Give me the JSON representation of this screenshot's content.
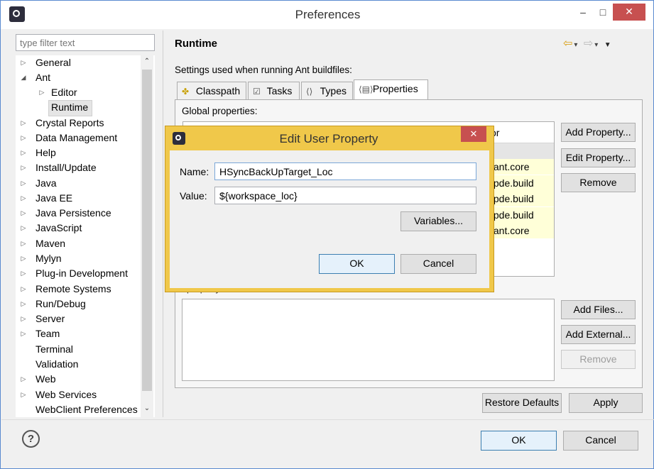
{
  "window": {
    "title": "Preferences",
    "controls": {
      "minimize": "–",
      "maximize": "□",
      "close": "✕"
    }
  },
  "sidebar": {
    "filter_placeholder": "type filter text",
    "items": [
      {
        "label": "General",
        "expandable": true,
        "expanded": false
      },
      {
        "label": "Ant",
        "expandable": true,
        "expanded": true
      },
      {
        "label": "Editor",
        "expandable": true,
        "expanded": false
      },
      {
        "label": "Runtime",
        "expandable": false,
        "selected": true
      },
      {
        "label": "Crystal Reports",
        "expandable": true
      },
      {
        "label": "Data Management",
        "expandable": true
      },
      {
        "label": "Help",
        "expandable": true
      },
      {
        "label": "Install/Update",
        "expandable": true
      },
      {
        "label": "Java",
        "expandable": true
      },
      {
        "label": "Java EE",
        "expandable": true
      },
      {
        "label": "Java Persistence",
        "expandable": true
      },
      {
        "label": "JavaScript",
        "expandable": true
      },
      {
        "label": "Maven",
        "expandable": true
      },
      {
        "label": "Mylyn",
        "expandable": true
      },
      {
        "label": "Plug-in Development",
        "expandable": true
      },
      {
        "label": "Remote Systems",
        "expandable": true
      },
      {
        "label": "Run/Debug",
        "expandable": true
      },
      {
        "label": "Server",
        "expandable": true
      },
      {
        "label": "Team",
        "expandable": true
      },
      {
        "label": "Terminal",
        "expandable": false
      },
      {
        "label": "Validation",
        "expandable": false
      },
      {
        "label": "Web",
        "expandable": true
      },
      {
        "label": "Web Services",
        "expandable": true
      },
      {
        "label": "WebClient Preferences",
        "expandable": false
      }
    ]
  },
  "page": {
    "title": "Runtime",
    "description": "Settings used when running Ant buildfiles:",
    "tabs": [
      {
        "label": "Classpath",
        "icon": "classpath-icon"
      },
      {
        "label": "Tasks",
        "icon": "tasks-icon"
      },
      {
        "label": "Types",
        "icon": "types-icon"
      },
      {
        "label": "Properties",
        "icon": "properties-icon",
        "active": true
      }
    ],
    "global_properties_label": "Global properties:",
    "table": {
      "visible_header_fragment": "or",
      "visible_cell_fragments": [
        ".ant.core",
        ".pde.build",
        ".pde.build",
        ".pde.build",
        ".ant.core"
      ]
    },
    "hidden_label_fragment": "properly",
    "buttons": {
      "add_property": "Add Property...",
      "edit_property": "Edit Property...",
      "remove": "Remove",
      "add_files": "Add Files...",
      "add_external": "Add External...",
      "remove_disabled": "Remove",
      "restore_defaults": "Restore Defaults",
      "apply": "Apply"
    }
  },
  "footer": {
    "help": "?",
    "ok": "OK",
    "cancel": "Cancel"
  },
  "dialog": {
    "title": "Edit User Property",
    "close": "✕",
    "name_label": "Name:",
    "name_value": "HSyncBackUpTarget_Loc",
    "value_label": "Value:",
    "value_value": "${workspace_loc}",
    "variables_button": "Variables...",
    "ok": "OK",
    "cancel": "Cancel"
  },
  "colors": {
    "dialog_frame": "#f0c84a",
    "close_red": "#c75050",
    "selection_gray": "#e5e5e5",
    "default_button_blue": "#e5f1fb"
  }
}
